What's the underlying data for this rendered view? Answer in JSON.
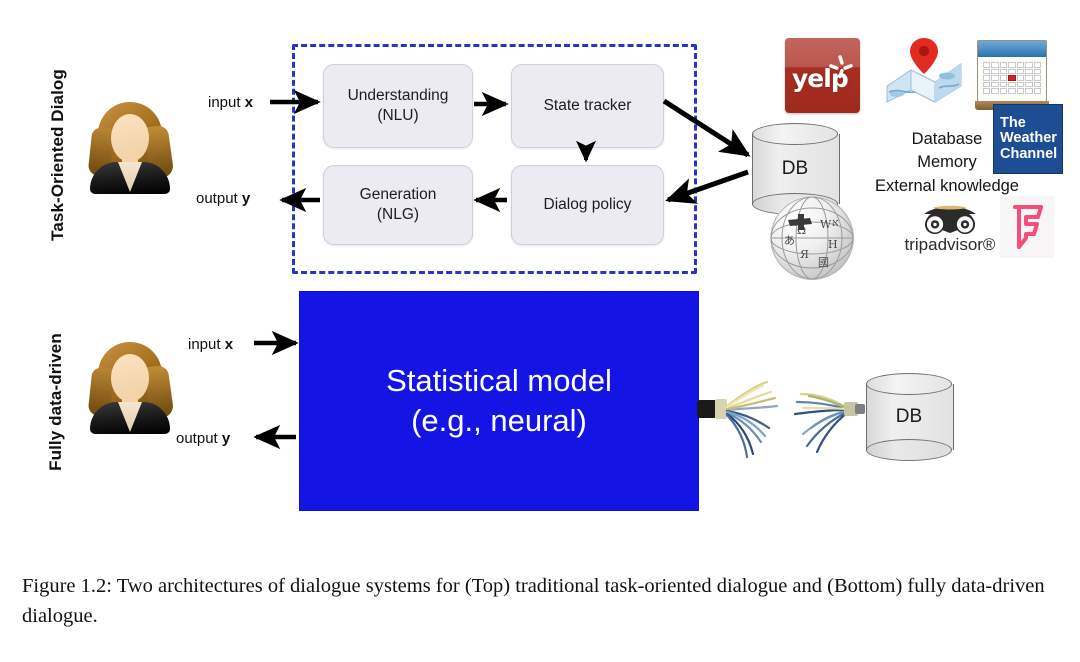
{
  "figure": {
    "caption": "Figure 1.2: Two architectures of dialogue systems for (Top) traditional task-oriented dialogue and (Bottom) fully data-driven dialogue."
  },
  "top_section": {
    "row_label": "Task-Oriented Dialog",
    "avatar_name": "user-avatar",
    "input_label_text": "input ",
    "input_label_var": "x",
    "output_label_text": "output ",
    "output_label_var": "y",
    "boxes": [
      {
        "id": "nlu",
        "line1": "Understanding",
        "line2": "(NLU)"
      },
      {
        "id": "state_tracker",
        "line1": "State tracker",
        "line2": ""
      },
      {
        "id": "nlg",
        "line1": "Generation",
        "line2": "(NLG)"
      },
      {
        "id": "dialog_policy",
        "line1": "Dialog policy",
        "line2": ""
      }
    ],
    "database": {
      "label": "DB"
    },
    "knowledge": {
      "line1": "Database",
      "line2": "Memory",
      "line3": "External knowledge"
    },
    "logos": [
      {
        "name": "yelp",
        "word": "yelp"
      },
      {
        "name": "google-maps",
        "word": ""
      },
      {
        "name": "calendar",
        "word": ""
      },
      {
        "name": "weather-channel",
        "line1": "The",
        "line2": "Weather",
        "line3": "Channel"
      },
      {
        "name": "wikipedia",
        "word": ""
      },
      {
        "name": "tripadvisor",
        "word": "tripadvisor®"
      },
      {
        "name": "foursquare",
        "word": ""
      }
    ]
  },
  "bottom_section": {
    "row_label": "Fully data-driven",
    "avatar_name": "user-avatar",
    "input_label_text": "input ",
    "input_label_var": "x",
    "output_label_text": "output ",
    "output_label_var": "y",
    "model_box": {
      "line1": "Statistical model",
      "line2": "(e.g., neural)"
    },
    "database": {
      "label": "DB"
    }
  },
  "colors": {
    "dashed_border": "#2a34c8",
    "model_box_fill": "#1414e4",
    "box_fill": "#ecebf1",
    "yelp_red": "#a62f21",
    "weather_blue": "#1d4d92",
    "foursquare_pink": "#f54e7a",
    "arrow": "#000000"
  }
}
